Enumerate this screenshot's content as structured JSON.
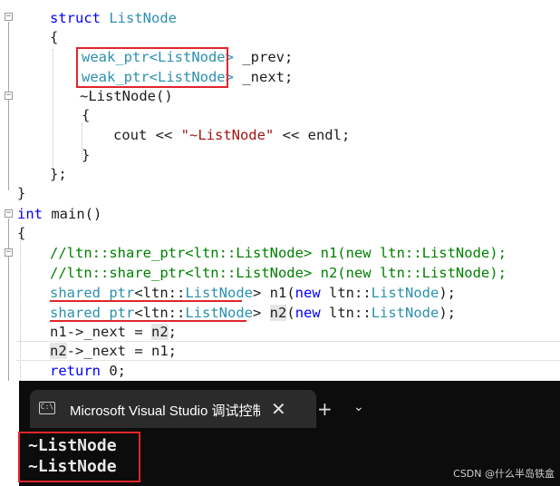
{
  "editor": {
    "lines": {
      "l1_kw": "struct",
      "l1_name": "ListNode",
      "l2": "{",
      "l3_type": "weak_ptr<ListNode>",
      "l3_var": "_prev;",
      "l4_type": "weak_ptr<ListNode>",
      "l4_var": "_next;",
      "l5": "~ListNode()",
      "l6": "{",
      "l7_a": "cout << ",
      "l7_str": "\"~ListNode\"",
      "l7_b": " << endl;",
      "l8": "}",
      "l9": "};",
      "l10": "}",
      "l11_kw": "int",
      "l11_rest": " main()",
      "l12": "{",
      "l13": "//ltn::share_ptr<ltn::ListNode> n1(new ltn::ListNode);",
      "l14": "//ltn::share_ptr<ltn::ListNode> n2(new ltn::ListNode);",
      "l15_type_a": "shared_ptr",
      "l15_type_b": "<ltn::",
      "l15_type_c": "ListNode",
      "l15_type_d": ">",
      "l15_rest_a": " n1(",
      "l15_new": "new",
      "l15_rest_b": " ltn::",
      "l15_cls": "ListNode",
      "l15_rest_c": ");",
      "l16_type_a": "shared_ptr",
      "l16_type_b": "<ltn::",
      "l16_type_c": "ListNode",
      "l16_type_d": ">",
      "l16_rest_a": " ",
      "l16_n2": "n2",
      "l16_rest_b": "(",
      "l16_new": "new",
      "l16_rest_c": " ltn::",
      "l16_cls": "ListNode",
      "l16_rest_d": ");",
      "l17_a": "n1->_next = ",
      "l17_b": "n2",
      "l17_c": ";",
      "l18_a": "n2",
      "l18_b": "->_next = n1;",
      "l19_kw": "return",
      "l19_rest": " 0;"
    }
  },
  "terminal": {
    "tab_icon": "C:\\",
    "tab_title": "Microsoft Visual Studio 调试控制台",
    "close_glyph": "✕",
    "new_tab_glyph": "+",
    "dropdown_glyph": "⌄",
    "output": [
      "~ListNode",
      "~ListNode"
    ]
  },
  "watermark": "CSDN @什么半岛铁盒",
  "colors": {
    "keyword": "#0000ff",
    "type": "#2b91af",
    "comment": "#008000",
    "string": "#a31515",
    "highlight_red": "#e0262c"
  }
}
